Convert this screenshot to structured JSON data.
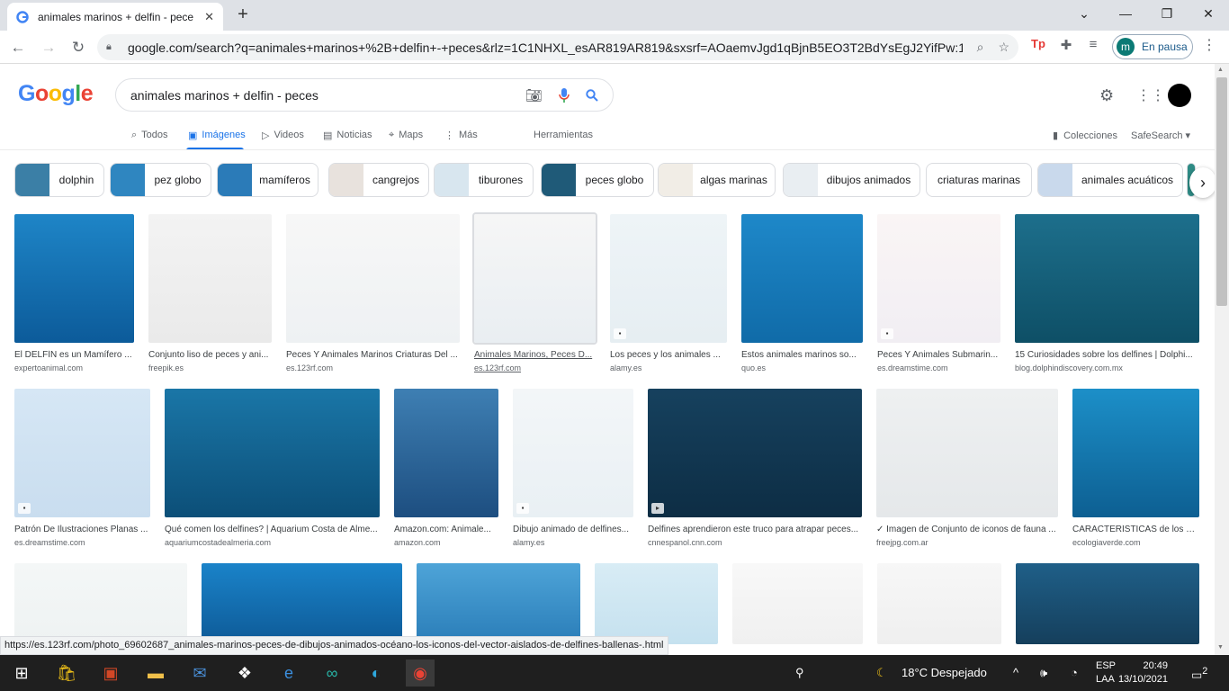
{
  "browser": {
    "tab_title": "animales marinos + delfin - pece",
    "url": "google.com/search?q=animales+marinos+%2B+delfin+-+peces&rlz=1C1NHXL_esAR819AR819&sxsrf=AOaemvJgd1qBjnB5EO3T2BdYsEgJ2YifPw:1...",
    "profile_initial": "m",
    "profile_status": "En pausa"
  },
  "google": {
    "logo": {
      "G": "G",
      "o1": "o",
      "o2": "o",
      "g": "g",
      "l": "l",
      "e": "e"
    },
    "query": "animales marinos + delfin - peces",
    "tabs": [
      {
        "label": "Todos",
        "icon": "search-icon"
      },
      {
        "label": "Imágenes",
        "icon": "image-icon"
      },
      {
        "label": "Videos",
        "icon": "play-icon"
      },
      {
        "label": "Noticias",
        "icon": "news-icon"
      },
      {
        "label": "Maps",
        "icon": "pin-icon"
      },
      {
        "label": "Más",
        "icon": "more-icon"
      }
    ],
    "tools": "Herramientas",
    "collections": "Colecciones",
    "safesearch": "SafeSearch ▾"
  },
  "chips": [
    {
      "label": "dolphin",
      "color": "#3b7fa6"
    },
    {
      "label": "pez globo",
      "color": "#2f86c0"
    },
    {
      "label": "mamíferos",
      "color": "#2b7bb8"
    },
    {
      "label": "cangrejos",
      "color": "#e8e2dd"
    },
    {
      "label": "tiburones",
      "color": "#d8e6ef"
    },
    {
      "label": "peces globo",
      "color": "#1f5a78"
    },
    {
      "label": "algas marinas",
      "color": "#f1ede6"
    },
    {
      "label": "dibujos animados",
      "color": "#e9eef2"
    },
    {
      "label": "criaturas marinas",
      "color": ""
    },
    {
      "label": "animales acuáticos",
      "color": "#c9d9ec"
    }
  ],
  "results": [
    {
      "caption": "El DELFÍN es un Mamífero ...",
      "source": "expertoanimal.com",
      "bg": "linear-gradient(180deg,#1e85c7,#0c5b9a)"
    },
    {
      "caption": "Conjunto liso de peces y ani...",
      "source": "freepik.es",
      "bg": "linear-gradient(180deg,#f3f3f3,#eaeaea)"
    },
    {
      "caption": "Peces Y Animales Marinos Criaturas Del ...",
      "source": "es.123rf.com",
      "bg": "linear-gradient(180deg,#f7f7f7,#eef1f3)"
    },
    {
      "caption": "Animales Marinos, Peces D...",
      "source": "es.123rf.com",
      "bg": "linear-gradient(180deg,#f6f6f6,#e9eef2)"
    },
    {
      "caption": "Los peces y los animales ...",
      "source": "alamy.es",
      "bg": "linear-gradient(180deg,#eef4f7,#e6eef2)"
    },
    {
      "caption": "Estos animales marinos so...",
      "source": "quo.es",
      "bg": "linear-gradient(180deg,#1e88c9,#106ba8)"
    },
    {
      "caption": "Peces Y Animales Submarin...",
      "source": "es.dreamstime.com",
      "bg": "linear-gradient(180deg,#faf5f5,#f1eef3)"
    },
    {
      "caption": "15 Curiosidades sobre los delfines | Dolphi...",
      "source": "blog.dolphindiscovery.com.mx",
      "bg": "linear-gradient(180deg,#1d6f8c,#0e4f66)"
    },
    {
      "caption": "Patrón De Ilustraciones Planas ...",
      "source": "es.dreamstime.com",
      "bg": "linear-gradient(180deg,#d6e7f5,#c9ddef)"
    },
    {
      "caption": "Qué comen los delfines? | Aquarium Costa de Alme...",
      "source": "aquariumcostadealmeria.com",
      "bg": "linear-gradient(180deg,#1a76a7,#0c4f78)"
    },
    {
      "caption": "Amazon.com: Animale...",
      "source": "amazon.com",
      "bg": "linear-gradient(180deg,#3e7fb3,#1d4e80)"
    },
    {
      "caption": "Dibujo animado de delfines...",
      "source": "alamy.es",
      "bg": "linear-gradient(180deg,#f3f6f8,#e9f0f4)"
    },
    {
      "caption": "Delfines aprendieron este truco para atrapar peces...",
      "source": "cnnespanol.cnn.com",
      "bg": "linear-gradient(180deg,#16415e,#0d2d44)"
    },
    {
      "caption": "✓ Imagen de Conjunto de iconos de fauna ...",
      "source": "freejpg.com.ar",
      "bg": "linear-gradient(180deg,#eef0f1,#e5e8ea)"
    },
    {
      "caption": "CARACTERÍSTICAS de los D...",
      "source": "ecologiaverde.com",
      "bg": "linear-gradient(180deg,#1c8fc8,#0d5f92)"
    },
    {
      "caption": "",
      "source": "",
      "bg": "linear-gradient(180deg,#f4f7f7,#eef2f2)"
    },
    {
      "caption": "",
      "source": "",
      "bg": "linear-gradient(180deg,#1a83c9,#0e5a97)"
    },
    {
      "caption": "",
      "source": "",
      "bg": "linear-gradient(180deg,#4ea4d8,#2a7db8)"
    },
    {
      "caption": "",
      "source": "",
      "bg": "linear-gradient(180deg,#d8ecf5,#c5e1ef)"
    },
    {
      "caption": "",
      "source": "",
      "bg": "linear-gradient(180deg,#f8f8f8,#f0f0f0)"
    },
    {
      "caption": "",
      "source": "",
      "bg": "linear-gradient(180deg,#f7f7f7,#efefef)"
    },
    {
      "caption": "",
      "source": "",
      "bg": "linear-gradient(180deg,#1f5f88,#153f5c)"
    }
  ],
  "status_url": "https://es.123rf.com/photo_69602687_animales-marinos-peces-de-dibujos-animados-océano-los-iconos-del-vector-aislados-de-delfines-ballenas-.html",
  "taskbar": {
    "weather": "18°C  Despejado",
    "lang1": "ESP",
    "lang2": "LAA",
    "time": "20:49",
    "date": "13/10/2021",
    "notif": "2"
  }
}
